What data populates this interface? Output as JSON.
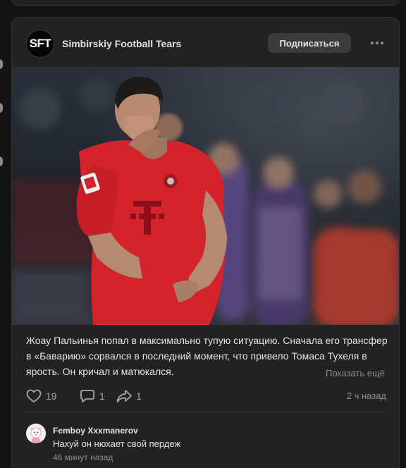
{
  "post": {
    "author": {
      "name": "Simbirskiy Football Tears",
      "avatar_text": "SFT"
    },
    "subscribe_label": "Подписаться",
    "text": "Жоау Пальинья попал в максимально тупую ситуацию. Сначала его трансфер в «Баварию» сорвался в последний момент, что привело Томаса Тухеля в ярость. Он кричал и матюкался.",
    "show_more_label": "Показать ещё",
    "likes": "19",
    "comments": "1",
    "shares": "1",
    "time": "2 ч назад"
  },
  "comment": {
    "author": "Femboy Xxxmanerov",
    "text": "Нахуй он нюхает свой пердеж",
    "time": "46 минут назад"
  },
  "colors": {
    "page_bg": "#141414",
    "card_bg": "#222222",
    "text_primary": "#e1e3e6",
    "text_secondary": "#8d8d8d",
    "jersey_red": "#d4232a"
  },
  "icons": [
    "more-dots-icon",
    "heart-icon",
    "comment-bubble-icon",
    "share-arrow-icon"
  ]
}
